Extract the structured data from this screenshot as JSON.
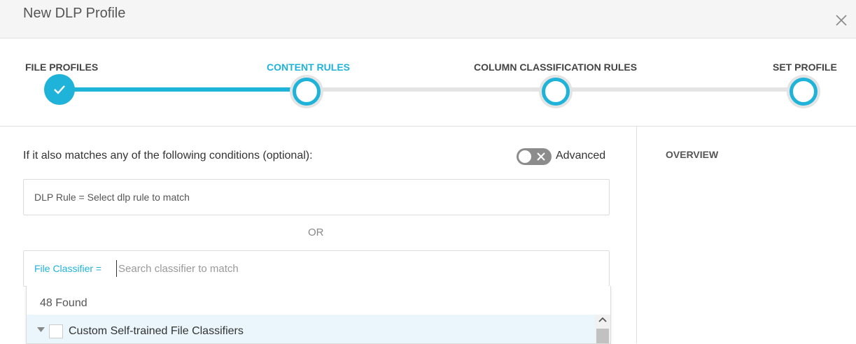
{
  "header": {
    "title": "New DLP Profile"
  },
  "steps": [
    {
      "label": "FILE PROFILES"
    },
    {
      "label": "CONTENT RULES"
    },
    {
      "label": "COLUMN CLASSIFICATION RULES"
    },
    {
      "label": "SET PROFILE"
    }
  ],
  "main": {
    "conditions_label": "If it also matches any of the following conditions (optional):",
    "advanced_label": "Advanced",
    "dlp_rule_text": "DLP Rule = Select dlp rule to match",
    "or_label": "OR",
    "file_classifier_label": "File Classifier =",
    "file_classifier_placeholder": "Search classifier to match",
    "found_text": "48 Found",
    "group_label": "Custom Self-trained File Classifiers"
  },
  "side": {
    "overview_label": "OVERVIEW"
  },
  "colors": {
    "accent": "#1fb3d9",
    "track": "#e4e4e4",
    "toggle_off": "#8c8c8c"
  },
  "icons": [
    "close-icon",
    "check-icon",
    "toggle-x-icon",
    "caret-down-icon",
    "scroll-up-arrow-icon"
  ]
}
